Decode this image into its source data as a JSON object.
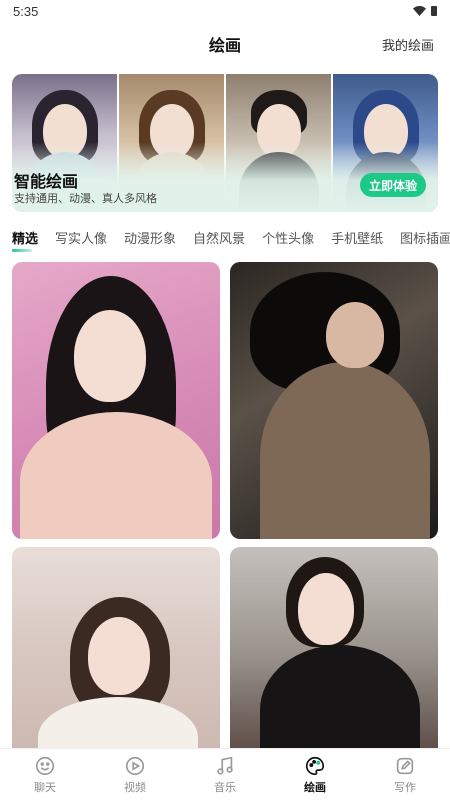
{
  "status_bar": {
    "time": "5:35"
  },
  "header": {
    "title": "绘画",
    "action": "我的绘画"
  },
  "banner": {
    "title": "智能绘画",
    "subtitle": "支持通用、动漫、真人多风格",
    "button": "立即体验"
  },
  "tabs": [
    {
      "label": "精选"
    },
    {
      "label": "写实人像"
    },
    {
      "label": "动漫形象"
    },
    {
      "label": "自然风景"
    },
    {
      "label": "个性头像"
    },
    {
      "label": "手机壁纸"
    },
    {
      "label": "图标插画"
    }
  ],
  "active_tab": "精选",
  "accent_color": "#1ec887",
  "bottom_nav": [
    {
      "label": "聊天",
      "icon": "smile-icon"
    },
    {
      "label": "视频",
      "icon": "play-icon"
    },
    {
      "label": "音乐",
      "icon": "music-icon"
    },
    {
      "label": "绘画",
      "icon": "palette-icon"
    },
    {
      "label": "写作",
      "icon": "edit-icon"
    }
  ],
  "active_nav": "绘画"
}
